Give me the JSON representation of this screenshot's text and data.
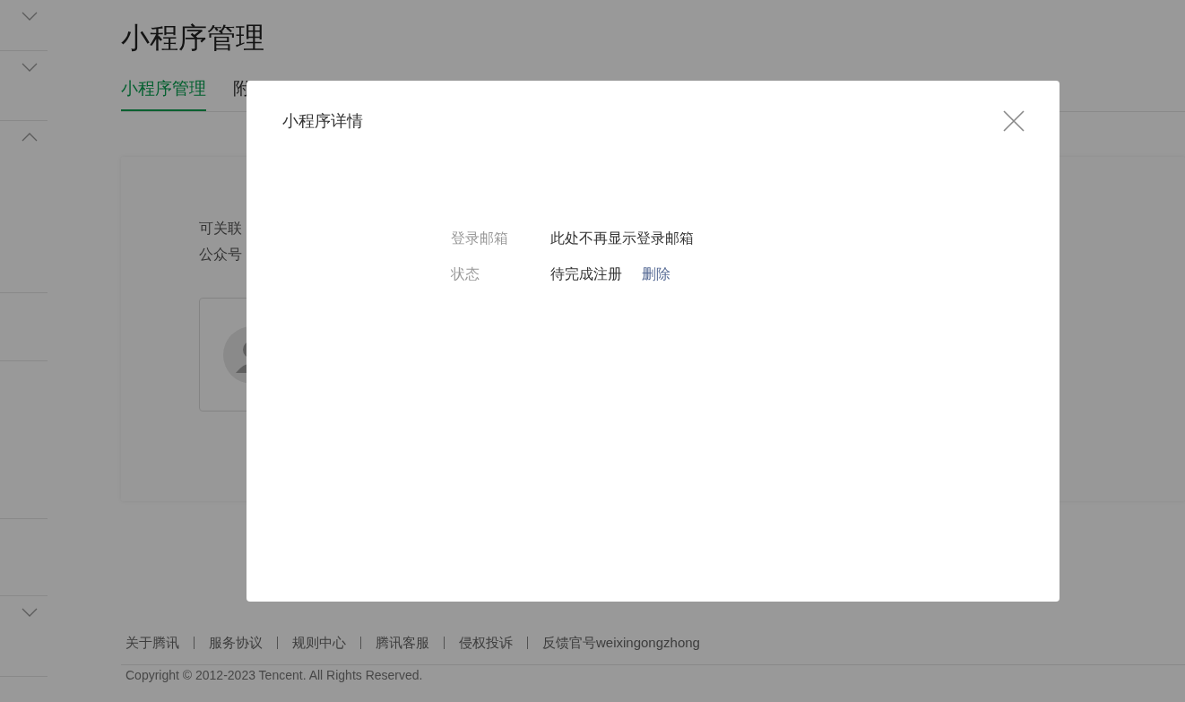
{
  "sidebar": {
    "sections": [
      {
        "kind": "group",
        "expanded": false
      },
      {
        "kind": "group",
        "expanded": false
      },
      {
        "kind": "group",
        "expanded": true
      },
      {
        "kind": "item"
      },
      {
        "kind": "item"
      },
      {
        "kind": "item"
      },
      {
        "kind": "group",
        "expanded": false
      }
    ]
  },
  "page": {
    "title": "小程序管理",
    "tabs": [
      {
        "label": "小程序管理",
        "selected": true
      },
      {
        "label": "附",
        "selected": false
      }
    ],
    "card": {
      "description_lines": [
        "可关联",
        "公众号"
      ],
      "account": {
        "kind": "avatar"
      }
    }
  },
  "dialog": {
    "title": "小程序详情",
    "fields": [
      {
        "label": "登录邮箱",
        "value": "此处不再显示登录邮箱"
      },
      {
        "label": "状态",
        "value": "待完成注册",
        "action": "删除"
      }
    ]
  },
  "footer": {
    "links": [
      "关于腾讯",
      "服务协议",
      "规则中心",
      "腾讯客服",
      "侵权投诉",
      "反馈官号weixingongzhong"
    ],
    "copyright": "Copyright © 2012-2023 Tencent. All Rights Reserved."
  }
}
